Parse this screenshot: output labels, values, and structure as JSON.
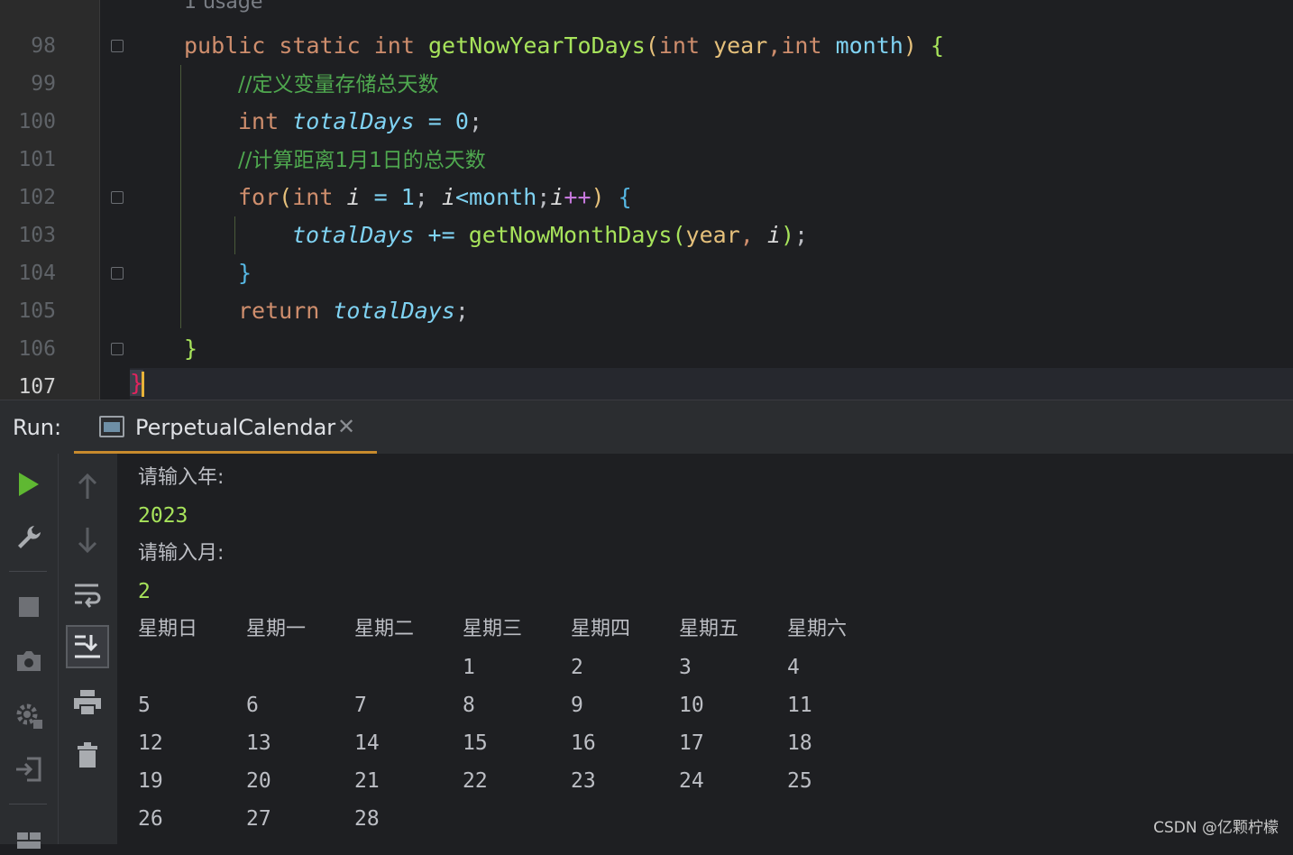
{
  "editor": {
    "usage_hint": "1 usage",
    "line_numbers": [
      "98",
      "99",
      "100",
      "101",
      "102",
      "103",
      "104",
      "105",
      "106",
      "107"
    ],
    "current_line": "107",
    "lines": {
      "l98": {
        "kw1": "public",
        "kw2": "static",
        "kw3": "int",
        "fn": "getNowYearToDays",
        "lp": "(",
        "kw4": "int",
        "p1": "year",
        "comma": ",",
        "kw5": "int",
        "p2": "month",
        "rp": ")",
        "brace": "{"
      },
      "l99": {
        "comment": "//定义变量存储总天数"
      },
      "l100": {
        "kw": "int",
        "var": "totalDays",
        "op": "=",
        "num": "0",
        "semi": ";"
      },
      "l101": {
        "comment": "//计算距离1月1日的总天数"
      },
      "l102": {
        "kw1": "for",
        "lp": "(",
        "kw2": "int",
        "v1": "i",
        "op1": "=",
        "num": "1",
        "semi1": ";",
        "v2": "i",
        "lt": "<",
        "month": "month",
        "semi2": ";",
        "v3": "i",
        "inc": "++",
        "rp": ")",
        "brace": "{"
      },
      "l103": {
        "var": "totalDays",
        "op": "+=",
        "fn": "getNowMonthDays",
        "lp": "(",
        "p1": "year",
        "comma": ",",
        "v": "i",
        "rp": ")",
        "semi": ";"
      },
      "l104": {
        "brace": "}"
      },
      "l105": {
        "kw": "return",
        "var": "totalDays",
        "semi": ";"
      },
      "l106": {
        "brace": "}"
      },
      "l107": {
        "brace": "}"
      }
    }
  },
  "run_panel": {
    "label": "Run:",
    "tab_label": "PerpetualCalendar",
    "tab_close": "✕"
  },
  "console": {
    "prompt_year": "请输入年:",
    "input_year": "2023",
    "prompt_month": "请输入月:",
    "input_month": "2",
    "weekday_headers": [
      "星期日",
      "星期一",
      "星期二",
      "星期三",
      "星期四",
      "星期五",
      "星期六"
    ],
    "calendar_rows": [
      [
        "",
        "",
        "",
        "1",
        "2",
        "3",
        "4"
      ],
      [
        "5",
        "6",
        "7",
        "8",
        "9",
        "10",
        "11"
      ],
      [
        "12",
        "13",
        "14",
        "15",
        "16",
        "17",
        "18"
      ],
      [
        "19",
        "20",
        "21",
        "22",
        "23",
        "24",
        "25"
      ],
      [
        "26",
        "27",
        "28",
        "",
        "",
        "",
        ""
      ]
    ]
  },
  "toolbar_left": [
    "run-icon",
    "wrench-icon",
    "stop-icon",
    "camera-icon",
    "settings-gear-icon",
    "login-icon",
    "layout-icon"
  ],
  "toolbar_right": [
    "up-arrow-icon",
    "down-arrow-icon",
    "soft-wrap-icon",
    "scroll-to-end-icon",
    "print-icon",
    "trash-icon"
  ],
  "watermark": "CSDN @亿颗柠檬",
  "colors": {
    "keyword": "#cf8e6d",
    "function": "#a7e35b",
    "variable": "#7fd2f2",
    "comment": "#4fa84f",
    "accent": "#c78a2d"
  }
}
